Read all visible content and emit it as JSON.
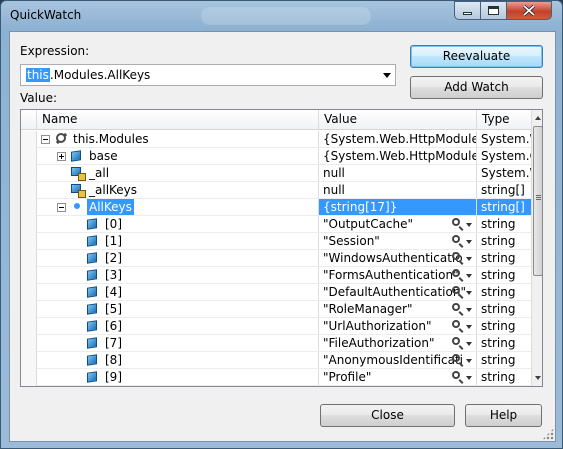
{
  "window": {
    "title": "QuickWatch"
  },
  "expression": {
    "label": "Expression:",
    "value": "this.Modules.AllKeys",
    "highlighted_part": "this",
    "rest_part": ".Modules.AllKeys"
  },
  "value_label": "Value:",
  "buttons": {
    "reevaluate": "Reevaluate",
    "add_watch": "Add Watch",
    "close": "Close",
    "help": "Help"
  },
  "grid": {
    "columns": [
      "Name",
      "Value",
      "Type"
    ],
    "rows": [
      {
        "name": "this.Modules",
        "value": "{System.Web.HttpModuleCo",
        "type": "System.W",
        "icon": "wrench-icon",
        "expander": "minus",
        "level": 0,
        "selected": false,
        "tools": false
      },
      {
        "name": "base",
        "value": "{System.Web.HttpModuleCo",
        "type": "System.C",
        "icon": "field-icon",
        "expander": "plus",
        "level": 1,
        "selected": false,
        "tools": false
      },
      {
        "name": "_all",
        "value": "null",
        "type": "System.W",
        "icon": "private-field-icon",
        "expander": "none",
        "level": 1,
        "selected": false,
        "tools": false
      },
      {
        "name": "_allKeys",
        "value": "null",
        "type": "string[]",
        "icon": "private-field-icon",
        "expander": "none",
        "level": 1,
        "selected": false,
        "tools": false
      },
      {
        "name": "AllKeys",
        "value": "{string[17]}",
        "type": "string[]",
        "icon": "wrench-icon",
        "expander": "minus",
        "level": 1,
        "selected": true,
        "tools": false
      },
      {
        "name": "[0]",
        "value": "\"OutputCache\"",
        "type": "string",
        "icon": "field-icon",
        "expander": "none",
        "level": 2,
        "selected": false,
        "tools": true
      },
      {
        "name": "[1]",
        "value": "\"Session\"",
        "type": "string",
        "icon": "field-icon",
        "expander": "none",
        "level": 2,
        "selected": false,
        "tools": true
      },
      {
        "name": "[2]",
        "value": "\"WindowsAuthenticatio",
        "type": "string",
        "icon": "field-icon",
        "expander": "none",
        "level": 2,
        "selected": false,
        "tools": true
      },
      {
        "name": "[3]",
        "value": "\"FormsAuthentication\"",
        "type": "string",
        "icon": "field-icon",
        "expander": "none",
        "level": 2,
        "selected": false,
        "tools": true
      },
      {
        "name": "[4]",
        "value": "\"DefaultAuthentication\"",
        "type": "string",
        "icon": "field-icon",
        "expander": "none",
        "level": 2,
        "selected": false,
        "tools": true
      },
      {
        "name": "[5]",
        "value": "\"RoleManager\"",
        "type": "string",
        "icon": "field-icon",
        "expander": "none",
        "level": 2,
        "selected": false,
        "tools": true
      },
      {
        "name": "[6]",
        "value": "\"UrlAuthorization\"",
        "type": "string",
        "icon": "field-icon",
        "expander": "none",
        "level": 2,
        "selected": false,
        "tools": true
      },
      {
        "name": "[7]",
        "value": "\"FileAuthorization\"",
        "type": "string",
        "icon": "field-icon",
        "expander": "none",
        "level": 2,
        "selected": false,
        "tools": true
      },
      {
        "name": "[8]",
        "value": "\"AnonymousIdentificati",
        "type": "string",
        "icon": "field-icon",
        "expander": "none",
        "level": 2,
        "selected": false,
        "tools": true
      },
      {
        "name": "[9]",
        "value": "\"Profile\"",
        "type": "string",
        "icon": "field-icon",
        "expander": "none",
        "level": 2,
        "selected": false,
        "tools": true
      }
    ]
  }
}
